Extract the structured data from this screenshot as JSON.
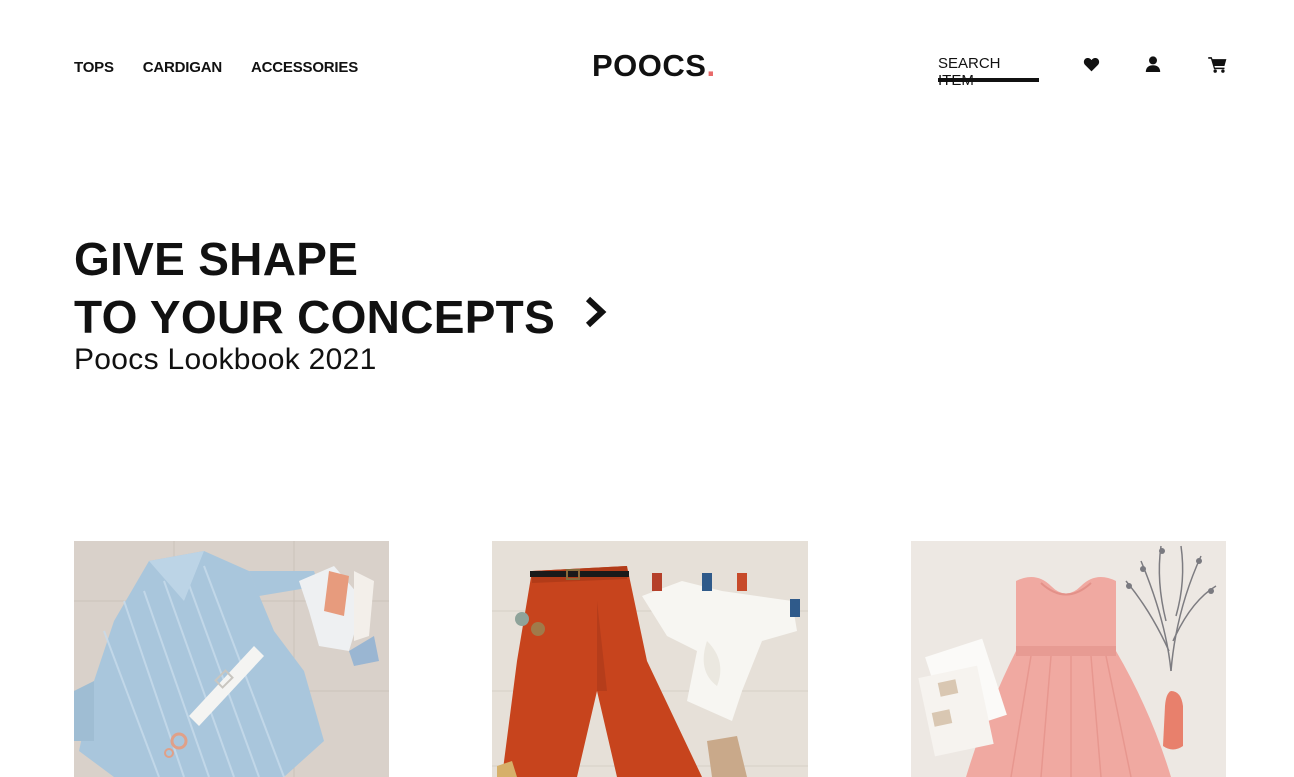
{
  "nav": {
    "items": [
      {
        "label": "TOPS"
      },
      {
        "label": "CARDIGAN"
      },
      {
        "label": "ACCESSORIES"
      }
    ]
  },
  "brand": {
    "name": "POOCS",
    "dot": ".",
    "accent_color": "#e86a6a"
  },
  "search": {
    "label": "SEARCH ITEM"
  },
  "icons": {
    "wishlist": "heart-icon",
    "account": "user-icon",
    "cart": "cart-icon",
    "hero_arrow": "chevron-right-icon"
  },
  "hero": {
    "title_line1": "GIVE SHAPE",
    "title_line2": "TO YOUR CONCEPTS",
    "subtitle": "Poocs Lookbook 2021"
  },
  "products": [
    {
      "name": "light blue striped shirt dress"
    },
    {
      "name": "rust wide-leg trousers with white top"
    },
    {
      "name": "pink sleeveless dress"
    }
  ]
}
